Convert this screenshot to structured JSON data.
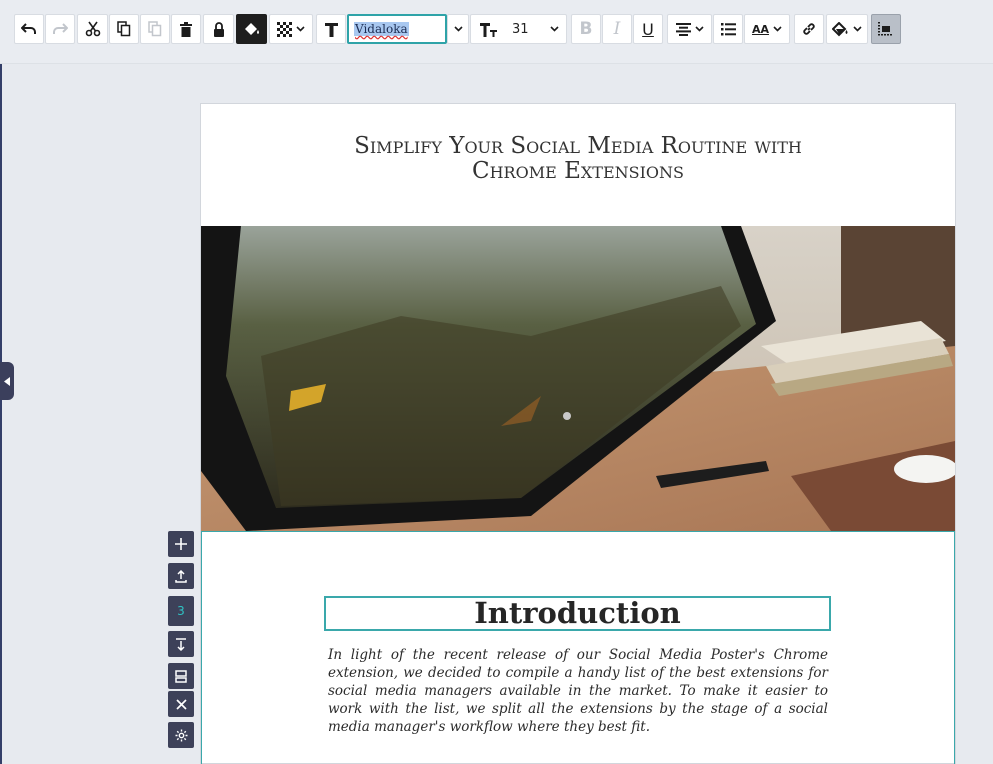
{
  "toolbar": {
    "font_name": "Vidaloka",
    "font_size": "31",
    "icons": [
      "undo-icon",
      "redo-icon",
      "cut-icon",
      "copy-icon",
      "paste-icon",
      "trash-icon",
      "lock-icon",
      "fill-bucket-icon",
      "pattern-icon",
      "text-icon",
      "font-size-icon",
      "bold-icon",
      "italic-icon",
      "underline-icon",
      "align-center-icon",
      "list-icon",
      "text-case-icon",
      "link-icon",
      "shape-fill-icon",
      "arrange-icon"
    ],
    "bold_label": "B",
    "italic_label": "I",
    "underline_label": "U",
    "text_case_label": "AA",
    "accent_color": "#2ea3a8"
  },
  "sections": {
    "current_number": "3"
  },
  "document": {
    "title_line1": "Simplify Your Social Media Routine with",
    "title_line2": "Chrome Extensions",
    "heading": "Introduction",
    "paragraph": "In light of the recent release of our Social Media Poster's Chrome extension, we decided to compile a handy list of the best extensions for social media managers available in the market. To make it easier to work with the list, we split all the extensions by the stage of a social media manager's workflow where they best fit."
  }
}
